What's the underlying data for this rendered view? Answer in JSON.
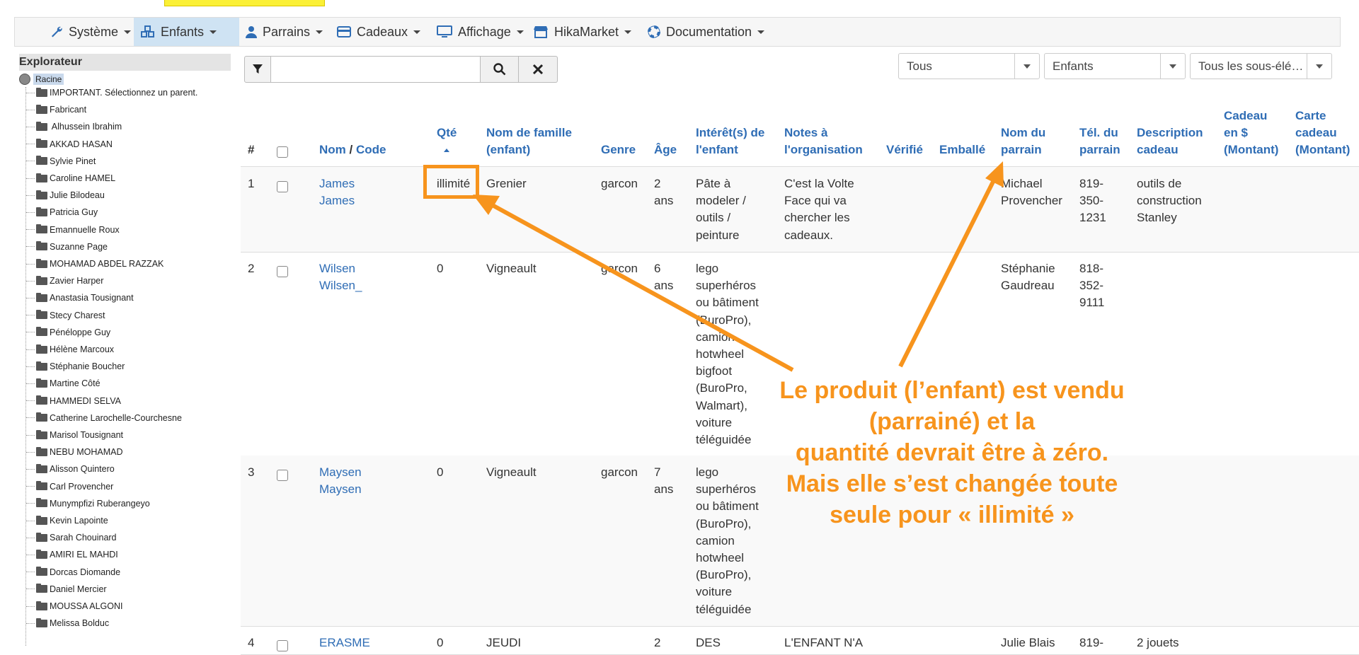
{
  "menu": [
    {
      "label": "Système",
      "icon": "wrench-icon"
    },
    {
      "label": "Enfants",
      "icon": "cubes-icon",
      "active": true
    },
    {
      "label": "Parrains",
      "icon": "user-icon"
    },
    {
      "label": "Cadeaux",
      "icon": "credit-card-icon"
    },
    {
      "label": "Affichage",
      "icon": "monitor-icon"
    },
    {
      "label": "HikaMarket",
      "icon": "store-icon"
    },
    {
      "label": "Documentation",
      "icon": "life-ring-icon"
    }
  ],
  "explorer": {
    "title": "Explorateur",
    "root": "Racine",
    "items": [
      "IMPORTANT. Sélectionnez un parent.",
      "Fabricant",
      " Alhussein Ibrahim",
      "AKKAD HASAN",
      "Sylvie Pinet",
      "Caroline HAMEL",
      "Julie Bilodeau",
      "Patricia Guy",
      "Emannuelle Roux",
      "Suzanne Page",
      "MOHAMAD ABDEL RAZZAK",
      "Zavier Harper",
      "Anastasia Tousignant",
      "Stecy Charest",
      "Pénéloppe Guy",
      "Hélène Marcoux",
      "Stéphanie Boucher",
      "Martine Côté",
      "HAMMEDI SELVA",
      "Catherine Larochelle-Courchesne",
      "Marisol Tousignant",
      "NEBU MOHAMAD",
      "Alisson Quintero",
      "Carl Provencher",
      "Munympfizi Ruberangeyo",
      "Kevin Lapointe",
      "Sarah Chouinard",
      "AMIRI EL MAHDI",
      "Dorcas Diomande",
      "Daniel Mercier",
      "MOUSSA ALGONI",
      "Melissa Bolduc"
    ]
  },
  "search": {
    "value": ""
  },
  "filters": [
    "Tous",
    "Enfants",
    "Tous les sous-élé…"
  ],
  "table": {
    "headers": {
      "num": "#",
      "name_a": "Nom",
      "name_sep": " / ",
      "name_b": "Code",
      "qty": "Qté",
      "family": [
        "Nom de famille",
        "(enfant)"
      ],
      "gender": "Genre",
      "age": "Âge",
      "interests": [
        "Intérêt(s) de",
        "l'enfant"
      ],
      "notes": [
        "Notes à",
        "l'organisation"
      ],
      "verified": "Vérifié",
      "wrapped": "Emballé",
      "sponsor": [
        "Nom du",
        "parrain"
      ],
      "phone": [
        "Tél. du",
        "parrain"
      ],
      "desc": [
        "Description",
        "cadeau"
      ],
      "gift": [
        "Cadeau",
        "en $",
        "(Montant)"
      ],
      "card": [
        "Carte",
        "cadeau",
        "(Montant)"
      ]
    },
    "rows": [
      {
        "num": "1",
        "name": [
          "James",
          "James"
        ],
        "qty": "illimité",
        "family": "Grenier",
        "gender": "garcon",
        "age": [
          "2",
          "ans"
        ],
        "interests": [
          "Pâte à",
          "modeler /",
          "outils /",
          "peinture"
        ],
        "notes": [
          "C'est la Volte",
          "Face qui va",
          "chercher les",
          "cadeaux."
        ],
        "sponsor": [
          "Michael",
          "Provencher"
        ],
        "phone": [
          "819-",
          "350-",
          "1231"
        ],
        "desc": [
          "outils de",
          "construction",
          "Stanley"
        ]
      },
      {
        "num": "2",
        "name": [
          "Wilsen",
          "Wilsen_"
        ],
        "qty": "0",
        "family": "Vigneault",
        "gender": "garcon",
        "age": [
          "6",
          "ans"
        ],
        "interests": [
          "lego",
          "superhéros",
          "ou bâtiment",
          "(BuroPro),",
          "camion",
          "hotwheel",
          "bigfoot",
          "(BuroPro,",
          "Walmart),",
          "voiture",
          "téléguidée"
        ],
        "notes": [],
        "sponsor": [
          "Stéphanie",
          "Gaudreau"
        ],
        "phone": [
          "818-",
          "352-",
          "9111"
        ],
        "desc": []
      },
      {
        "num": "3",
        "name": [
          "Maysen",
          "Maysen"
        ],
        "qty": "0",
        "family": "Vigneault",
        "gender": "garcon",
        "age": [
          "7",
          "ans"
        ],
        "interests": [
          "lego",
          "superhéros",
          "ou bâtiment",
          "(BuroPro),",
          "camion",
          "hotwheel",
          "(BuroPro),",
          "voiture",
          "téléguidée"
        ],
        "notes": [],
        "sponsor": [],
        "phone": [],
        "desc": []
      },
      {
        "num": "4",
        "name": [
          "ERASME"
        ],
        "qty": "0",
        "family": "JEUDI",
        "gender": "",
        "age": [
          "2"
        ],
        "interests": [
          "DES"
        ],
        "notes": [
          "L'ENFANT N'A"
        ],
        "sponsor": [
          "Julie Blais"
        ],
        "phone": [
          "819-"
        ],
        "desc": [
          "2 jouets"
        ]
      }
    ]
  },
  "annotation": {
    "lines": [
      "Le produit (l’enfant) est vendu",
      "(parrainé) et la",
      "quantité devrait être à zéro.",
      "Mais elle s’est changée toute",
      "seule pour « illimité »"
    ],
    "color": "#f7941d"
  }
}
